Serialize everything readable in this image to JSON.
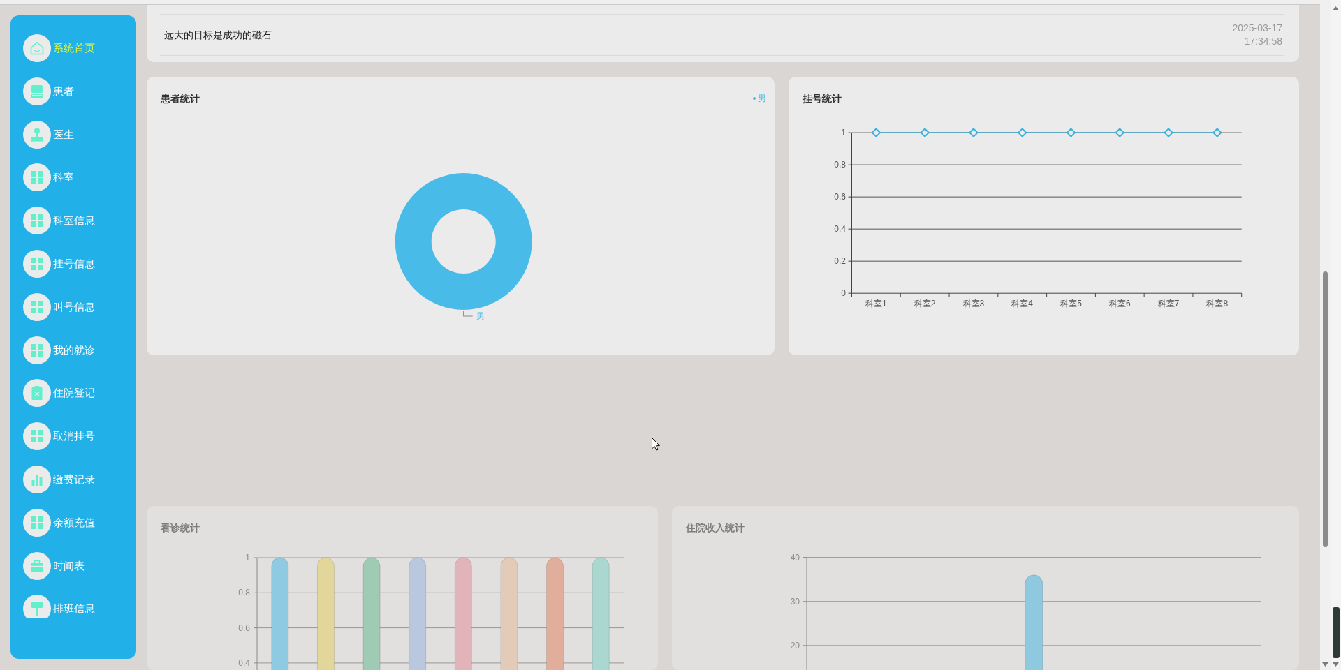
{
  "sidebar": {
    "items": [
      {
        "label": "系统首页",
        "kind": "home",
        "selected": true
      },
      {
        "label": "患者",
        "kind": "monitor",
        "selected": false
      },
      {
        "label": "医生",
        "kind": "stamp",
        "selected": false
      },
      {
        "label": "科室",
        "kind": "grid",
        "selected": false
      },
      {
        "label": "科室信息",
        "kind": "grid",
        "selected": false
      },
      {
        "label": "挂号信息",
        "kind": "grid",
        "selected": false
      },
      {
        "label": "叫号信息",
        "kind": "grid",
        "selected": false
      },
      {
        "label": "我的就诊",
        "kind": "grid",
        "selected": false
      },
      {
        "label": "住院登记",
        "kind": "clipboard",
        "selected": false
      },
      {
        "label": "取消挂号",
        "kind": "grid",
        "selected": false
      },
      {
        "label": "缴费记录",
        "kind": "chart",
        "selected": false
      },
      {
        "label": "余额充值",
        "kind": "grid",
        "selected": false
      },
      {
        "label": "时间表",
        "kind": "briefcase",
        "selected": false
      },
      {
        "label": "排班信息",
        "kind": "brush",
        "selected": false
      }
    ]
  },
  "notices": [
    {
      "title": "远大的目标是成功的磁石",
      "date": "2025-03-17",
      "time": "17:34:58"
    }
  ],
  "patient_stats": {
    "title": "患者统计",
    "legend": [
      {
        "label": "男",
        "color": "#49bbe9"
      }
    ],
    "donut": {
      "slice_labels": [
        "男"
      ]
    }
  },
  "registration_stats": {
    "title": "挂号统计",
    "chart_data": {
      "type": "line",
      "categories": [
        "科室1",
        "科室2",
        "科室3",
        "科室4",
        "科室5",
        "科室6",
        "科室7",
        "科室8"
      ],
      "values": [
        1,
        1,
        1,
        1,
        1,
        1,
        1,
        1
      ],
      "ylim": [
        0,
        1
      ],
      "yticks": [
        0,
        0.2,
        0.4,
        0.6,
        0.8,
        1
      ],
      "grid": true,
      "marker": "diamond"
    }
  },
  "visit_stats": {
    "title": "看诊统计",
    "bars": [
      {
        "color": "#8ecbe2"
      },
      {
        "color": "#e2d69a"
      },
      {
        "color": "#9fcab3"
      },
      {
        "color": "#b9c7df"
      },
      {
        "color": "#e2b3b9"
      },
      {
        "color": "#e2cbb9"
      },
      {
        "color": "#e1ae9c"
      },
      {
        "color": "#aad7cf"
      }
    ],
    "chart_data": {
      "type": "bar",
      "values": [
        1,
        1,
        1,
        1,
        1,
        1,
        1,
        1
      ],
      "ylim": [
        0,
        1
      ],
      "yticks": [
        0.4,
        0.6,
        0.8,
        1
      ],
      "grid": true
    }
  },
  "income_stats": {
    "title": "住院收入统计",
    "chart_data": {
      "type": "bar",
      "values": [
        36
      ],
      "ylim": [
        0,
        40
      ],
      "yticks": [
        20,
        30,
        40
      ],
      "grid": true
    }
  }
}
